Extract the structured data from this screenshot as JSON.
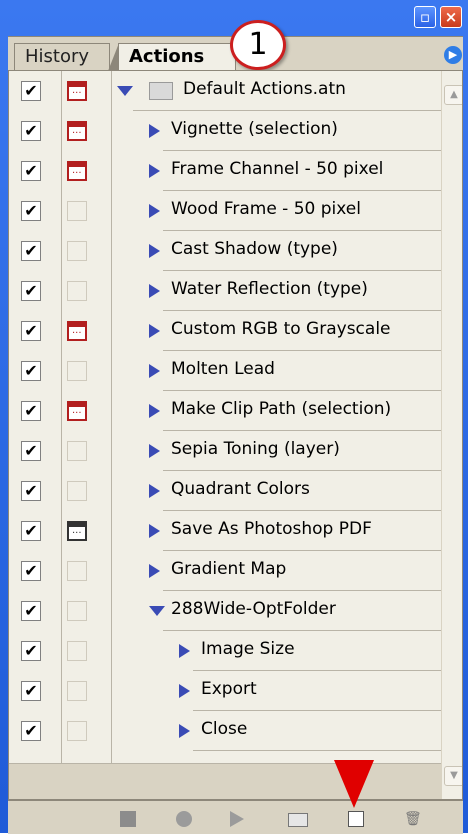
{
  "window": {
    "title_buttons": [
      "minimize-icon",
      "close-icon"
    ],
    "close_glyph": "×"
  },
  "tabs": [
    {
      "label": "History",
      "active": false
    },
    {
      "label": "Actions",
      "active": true
    }
  ],
  "callout": {
    "number": "1"
  },
  "menu_button_glyph": "▶",
  "rows": [
    {
      "label": "Default Actions.atn",
      "type": "set",
      "checked": true,
      "dialog": "red",
      "expanded": true
    },
    {
      "label": "Vignette (selection)",
      "type": "action",
      "checked": true,
      "dialog": "red"
    },
    {
      "label": "Frame Channel - 50 pixel",
      "type": "action",
      "checked": true,
      "dialog": "red"
    },
    {
      "label": "Wood Frame - 50 pixel",
      "type": "action",
      "checked": true,
      "dialog": "none"
    },
    {
      "label": "Cast Shadow (type)",
      "type": "action",
      "checked": true,
      "dialog": "none"
    },
    {
      "label": "Water Reflection (type)",
      "type": "action",
      "checked": true,
      "dialog": "none"
    },
    {
      "label": "Custom RGB to Grayscale",
      "type": "action",
      "checked": true,
      "dialog": "red"
    },
    {
      "label": "Molten Lead",
      "type": "action",
      "checked": true,
      "dialog": "none"
    },
    {
      "label": "Make Clip Path (selection)",
      "type": "action",
      "checked": true,
      "dialog": "red"
    },
    {
      "label": "Sepia Toning (layer)",
      "type": "action",
      "checked": true,
      "dialog": "none"
    },
    {
      "label": "Quadrant Colors",
      "type": "action",
      "checked": true,
      "dialog": "none"
    },
    {
      "label": "Save As Photoshop PDF",
      "type": "action",
      "checked": true,
      "dialog": "black"
    },
    {
      "label": "Gradient Map",
      "type": "action",
      "checked": true,
      "dialog": "none"
    },
    {
      "label": "288Wide-OptFolder",
      "type": "action",
      "checked": true,
      "dialog": "none",
      "expanded": true
    },
    {
      "label": "Image Size",
      "type": "step",
      "checked": true,
      "dialog": "none"
    },
    {
      "label": "Export",
      "type": "step",
      "checked": true,
      "dialog": "none"
    },
    {
      "label": "Close",
      "type": "step",
      "checked": true,
      "dialog": "none"
    }
  ],
  "check_glyph": "✔",
  "bottom_buttons": [
    "stop-icon",
    "record-icon",
    "play-icon",
    "new-set-icon",
    "new-action-icon",
    "delete-icon"
  ],
  "colors": {
    "title_blue": "#1f5bd8",
    "panel_bg": "#f1efe6",
    "triangle": "#3a4bb5",
    "dialog_red": "#b21f1f",
    "arrow_red": "#e00000",
    "callout_border": "#cc1f1f"
  }
}
